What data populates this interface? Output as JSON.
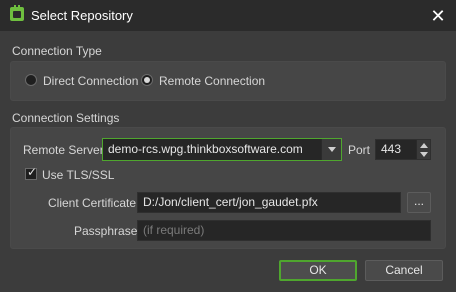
{
  "window": {
    "title": "Select Repository"
  },
  "connection_type": {
    "title": "Connection Type",
    "options": [
      {
        "label": "Direct Connection",
        "selected": false
      },
      {
        "label": "Remote Connection",
        "selected": true
      }
    ]
  },
  "connection_settings": {
    "title": "Connection Settings",
    "remote_server_label": "Remote Server",
    "remote_server_value": "demo-rcs.wpg.thinkboxsoftware.com",
    "port_label": "Port",
    "port_value": "443",
    "use_tls_label": "Use TLS/SSL",
    "use_tls_checked": true,
    "client_certificate_label": "Client Certificate",
    "client_certificate_value": "D:/Jon/client_cert/jon_gaudet.pfx",
    "browse_label": "...",
    "passphrase_label": "Passphrase",
    "passphrase_placeholder": "(if required)"
  },
  "buttons": {
    "ok": "OK",
    "cancel": "Cancel"
  },
  "colors": {
    "accent": "#4fa62e",
    "background": "#3c3c3c",
    "titlebar": "#2b2b2b"
  }
}
